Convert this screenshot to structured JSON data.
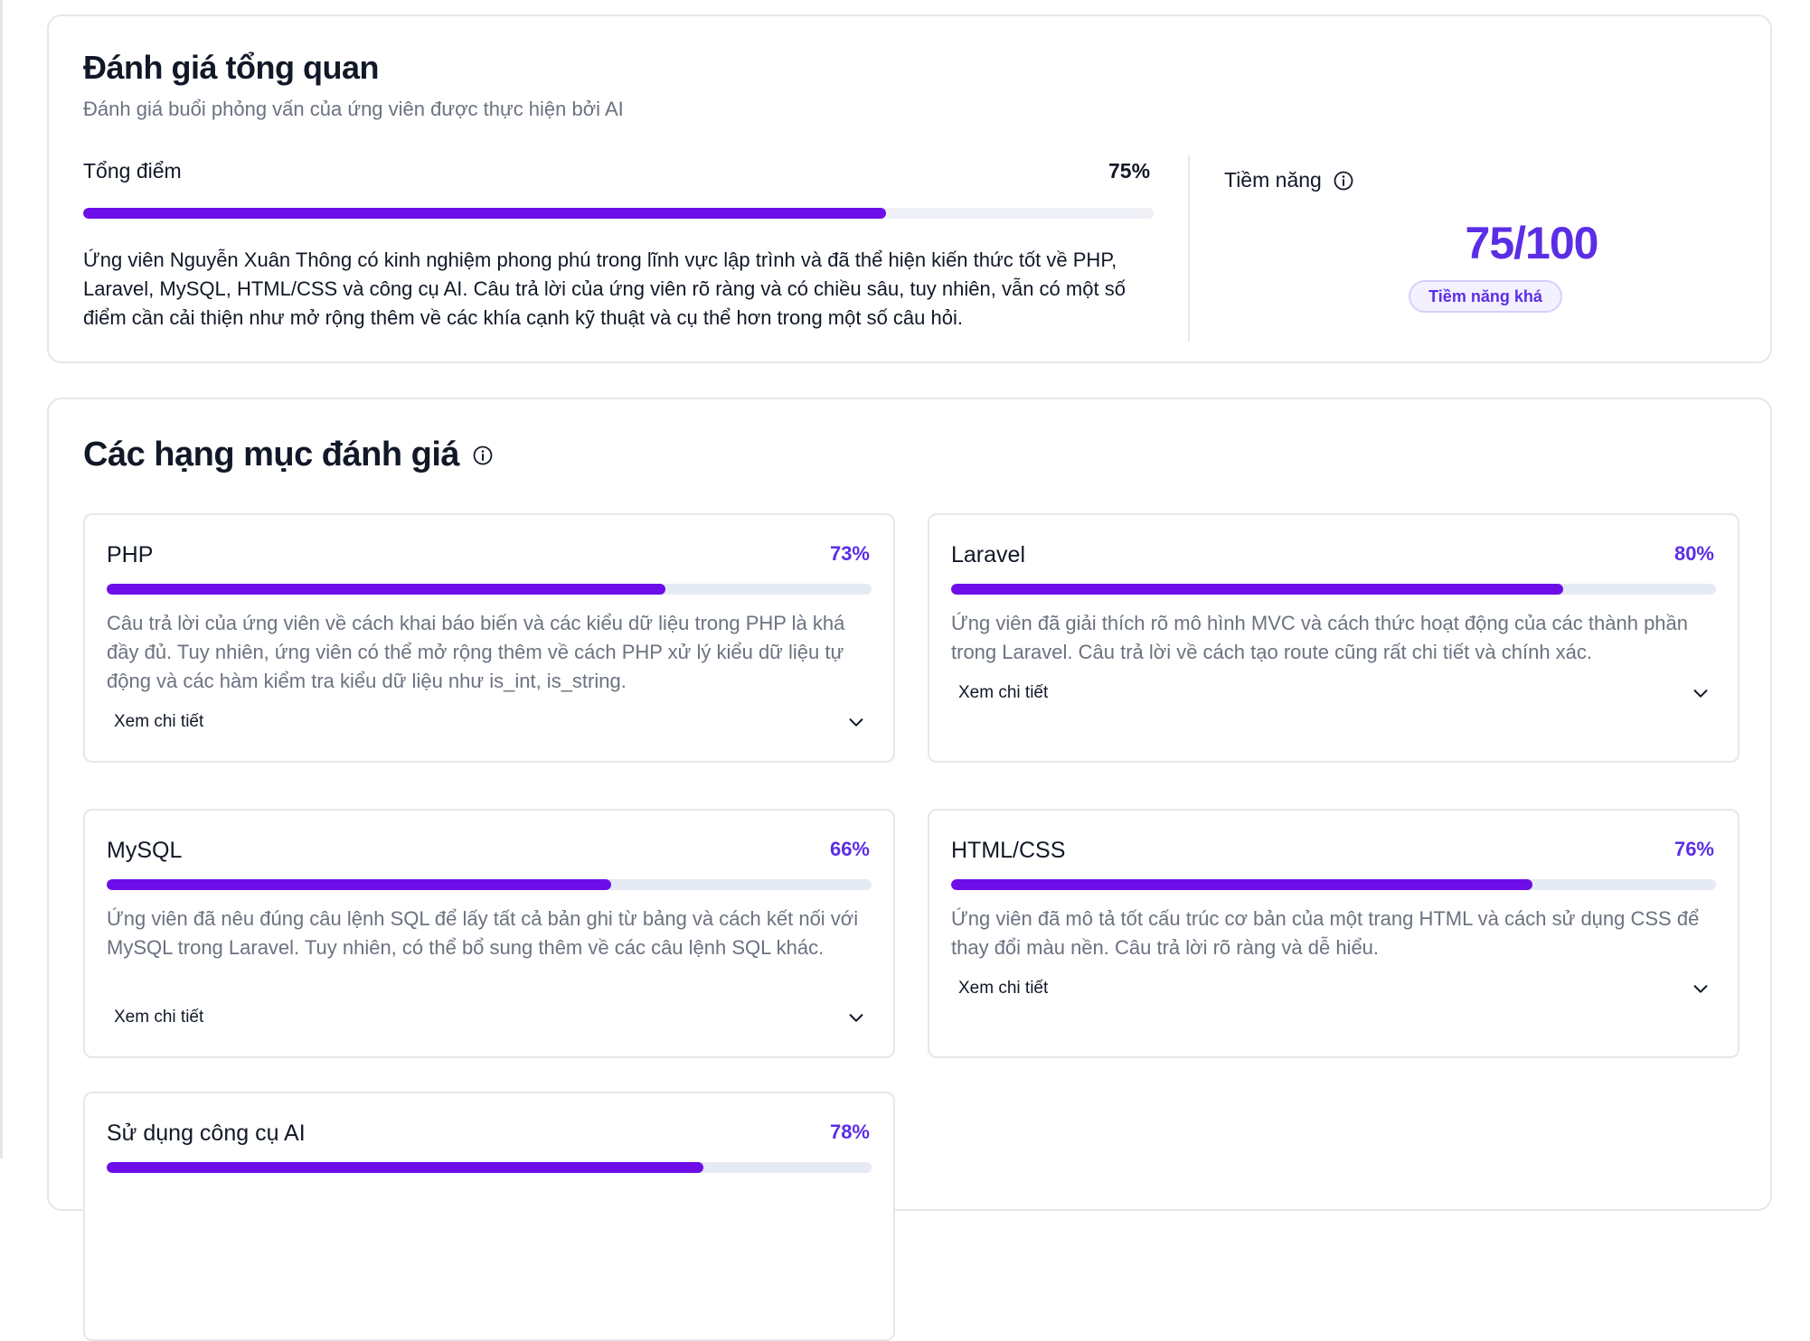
{
  "overview": {
    "title": "Đánh giá tổng quan",
    "subtitle": "Đánh giá buổi phỏng vấn của ứng viên được thực hiện bởi AI",
    "total_label": "Tổng điểm",
    "total_value": "75%",
    "total_fraction": 0.75,
    "summary": "Ứng viên Nguyễn Xuân Thông có kinh nghiệm phong phú trong lĩnh vực lập trình và đã thể hiện kiến thức tốt về PHP, Laravel, MySQL, HTML/CSS và công cụ AI. Câu trả lời của ứng viên rõ ràng và có chiều sâu, tuy nhiên, vẫn có một số điểm cần cải thiện như mở rộng thêm về các khía cạnh kỹ thuật và cụ thể hơn trong một số câu hỏi.",
    "potential_label": "Tiềm năng",
    "potential_score": "75/100",
    "potential_badge": "Tiềm năng khá"
  },
  "categories": {
    "title": "Các hạng mục đánh giá",
    "detail_label": "Xem chi tiết",
    "items": [
      {
        "name": "PHP",
        "pct": "73%",
        "fraction": 0.73,
        "desc": "Câu trả lời của ứng viên về cách khai báo biến và các kiểu dữ liệu trong PHP là khá đầy đủ. Tuy nhiên, ứng viên có thể mở rộng thêm về cách PHP xử lý kiểu dữ liệu tự động và các hàm kiểm tra kiểu dữ liệu như is_int, is_string."
      },
      {
        "name": "Laravel",
        "pct": "80%",
        "fraction": 0.8,
        "desc": "Ứng viên đã giải thích rõ mô hình MVC và cách thức hoạt động của các thành phần trong Laravel. Câu trả lời về cách tạo route cũng rất chi tiết và chính xác."
      },
      {
        "name": "MySQL",
        "pct": "66%",
        "fraction": 0.66,
        "desc": "Ứng viên đã nêu đúng câu lệnh SQL để lấy tất cả bản ghi từ bảng và cách kết nối với MySQL trong Laravel. Tuy nhiên, có thể bổ sung thêm về các câu lệnh SQL khác."
      },
      {
        "name": "HTML/CSS",
        "pct": "76%",
        "fraction": 0.76,
        "desc": "Ứng viên đã mô tả tốt cấu trúc cơ bản của một trang HTML và cách sử dụng CSS để thay đổi màu nền. Câu trả lời rõ ràng và dễ hiểu."
      },
      {
        "name": "Sử dụng công cụ AI",
        "pct": "78%",
        "fraction": 0.78,
        "desc": ""
      }
    ]
  }
}
